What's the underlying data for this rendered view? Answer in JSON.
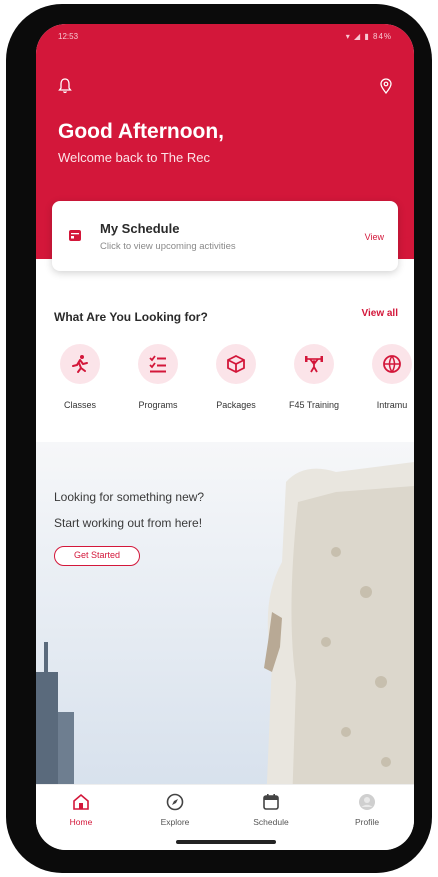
{
  "status": {
    "time": "12:53",
    "icons": "▾ ◢ ▮ 84%"
  },
  "header": {
    "greeting": "Good Afternoon,",
    "welcome": "Welcome back to The Rec"
  },
  "schedule_card": {
    "title": "My Schedule",
    "subtitle": "Click to view upcoming activities",
    "view_label": "View"
  },
  "categories_section": {
    "title": "What Are You Looking for?",
    "view_all": "View all",
    "items": [
      {
        "label": "Classes",
        "icon": "runner-icon"
      },
      {
        "label": "Programs",
        "icon": "list-icon"
      },
      {
        "label": "Packages",
        "icon": "box-icon"
      },
      {
        "label": "F45 Training",
        "icon": "weightlifter-icon"
      },
      {
        "label": "Intramu",
        "icon": "ball-icon"
      }
    ]
  },
  "promo": {
    "line1": "Looking for something new?",
    "line2": "Start working out from here!",
    "button": "Get Started"
  },
  "tabs": [
    {
      "label": "Home",
      "icon": "home-icon",
      "active": true
    },
    {
      "label": "Explore",
      "icon": "compass-icon",
      "active": false
    },
    {
      "label": "Schedule",
      "icon": "calendar-icon",
      "active": false
    },
    {
      "label": "Profile",
      "icon": "avatar-icon",
      "active": false
    }
  ],
  "colors": {
    "brand": "#d3173a",
    "accent_light": "#fbe4e9"
  }
}
